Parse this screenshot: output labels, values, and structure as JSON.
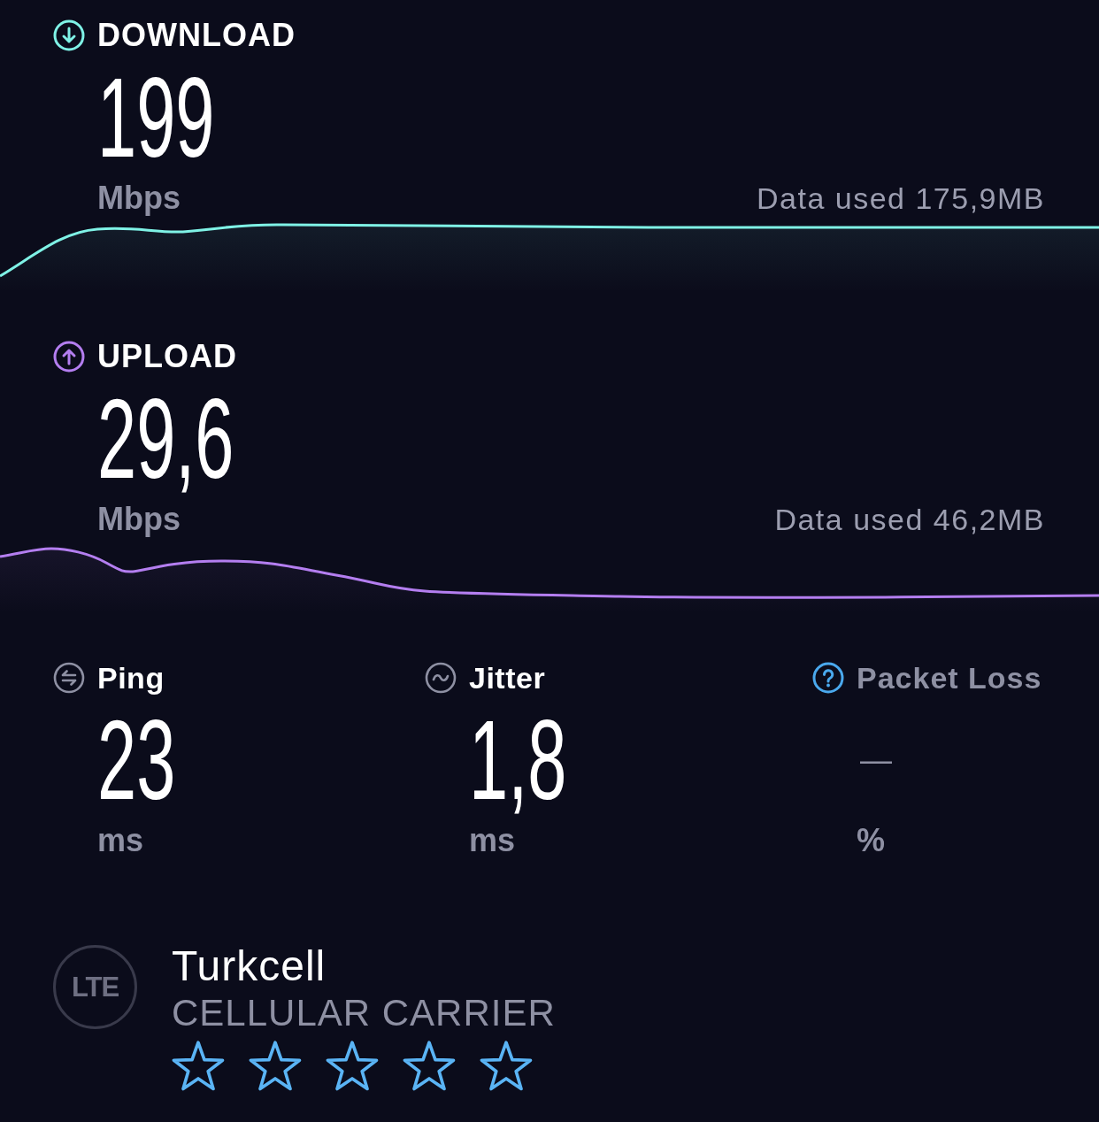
{
  "speeds": [
    {
      "kind": "download",
      "label": "DOWNLOAD",
      "value": "199",
      "unit": "Mbps",
      "data_used": "Data used 175,9MB",
      "color": "#7ff2e6"
    },
    {
      "kind": "upload",
      "label": "UPLOAD",
      "value": "29,6",
      "unit": "Mbps",
      "data_used": "Data used 46,2MB",
      "color": "#b47ef0"
    }
  ],
  "metrics": [
    {
      "kind": "ping",
      "label": "Ping",
      "value": "23",
      "unit": "ms",
      "disabled": false
    },
    {
      "kind": "jitter",
      "label": "Jitter",
      "value": "1,8",
      "unit": "ms",
      "disabled": false
    },
    {
      "kind": "packet_loss",
      "label": "Packet Loss",
      "value": "—",
      "unit": "%",
      "disabled": true
    }
  ],
  "carrier": {
    "network_type": "LTE",
    "name": "Turkcell",
    "type": "CELLULAR CARRIER",
    "stars": 0
  }
}
